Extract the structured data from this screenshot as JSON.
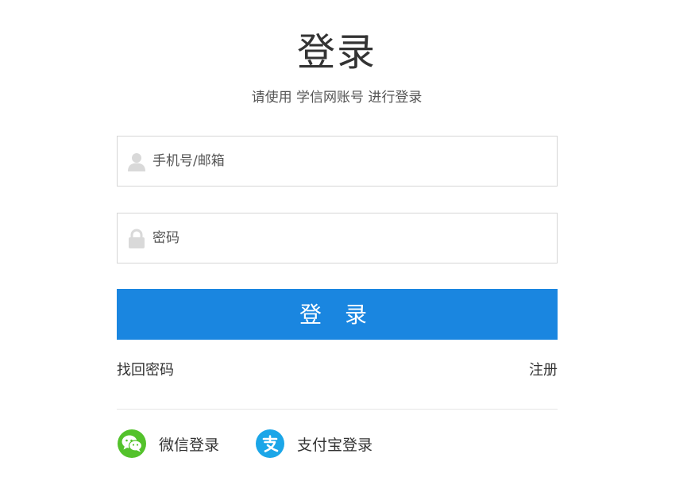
{
  "header": {
    "title": "登录",
    "subtitle": "请使用 学信网账号 进行登录"
  },
  "form": {
    "username_placeholder": "手机号/邮箱",
    "username_value": "",
    "password_placeholder": "密码",
    "password_value": "",
    "login_label": "登 录"
  },
  "links": {
    "forgot_password": "找回密码",
    "register": "注册"
  },
  "social": {
    "wechat_label": "微信登录",
    "alipay_label": "支付宝登录"
  },
  "icons": {
    "username": "user-icon",
    "password": "lock-icon",
    "wechat": "wechat-icon",
    "alipay": "alipay-icon"
  },
  "colors": {
    "primary": "#1a86e0",
    "wechat": "#53c22b",
    "alipay": "#1ba6e8",
    "border": "#d6d6d6"
  }
}
